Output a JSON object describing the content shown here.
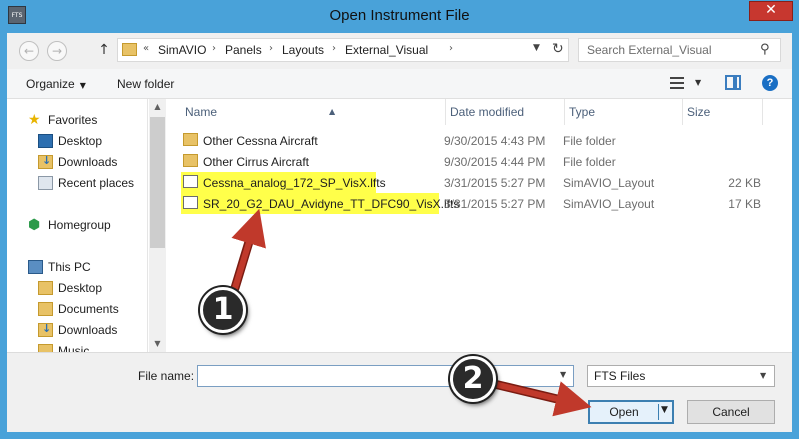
{
  "window": {
    "title": "Open Instrument File",
    "app_icon_text": "FTS",
    "close_symbol": "✕"
  },
  "nav": {
    "back_symbol": "←",
    "forward_symbol": "→",
    "up_symbol": "↑"
  },
  "address": {
    "prefix": "«",
    "crumbs": [
      "SimAVIO",
      "Panels",
      "Layouts",
      "External_Visual"
    ],
    "separator": "›",
    "dropdown_symbol": "▼",
    "refresh_symbol": "↻"
  },
  "search": {
    "placeholder": "Search External_Visual",
    "icon_symbol": "⚲"
  },
  "toolbar": {
    "organize_label": "Organize",
    "organize_caret": "▼",
    "new_folder_label": "New folder",
    "view_caret": "▼",
    "help_symbol": "?"
  },
  "sidebar": {
    "items": [
      {
        "label": "Favorites",
        "icon": "star-icon"
      },
      {
        "label": "Desktop",
        "icon": "desktop-icon"
      },
      {
        "label": "Downloads",
        "icon": "downloads-icon"
      },
      {
        "label": "Recent places",
        "icon": "recent-places-icon"
      },
      {
        "label": "Homegroup",
        "icon": "homegroup-icon"
      },
      {
        "label": "This PC",
        "icon": "this-pc-icon"
      },
      {
        "label": "Desktop",
        "icon": "desktop-icon"
      },
      {
        "label": "Documents",
        "icon": "documents-icon"
      },
      {
        "label": "Downloads",
        "icon": "downloads-icon"
      },
      {
        "label": "Music",
        "icon": "music-icon"
      }
    ],
    "star_symbol": "★",
    "home_symbol": "⬢",
    "scroll_up": "▲",
    "scroll_down": "▼"
  },
  "columns": {
    "name": "Name",
    "date": "Date modified",
    "type": "Type",
    "size": "Size",
    "sort_symbol": "▲"
  },
  "files": [
    {
      "name": "Other Cessna Aircraft",
      "date": "9/30/2015 4:43 PM",
      "type": "File folder",
      "size": "",
      "icon": "folder-icon",
      "highlighted": false
    },
    {
      "name": "Other Cirrus Aircraft",
      "date": "9/30/2015 4:44 PM",
      "type": "File folder",
      "size": "",
      "icon": "folder-icon",
      "highlighted": false
    },
    {
      "name": "Cessna_analog_172_SP_VisX.lfts",
      "date": "3/31/2015 5:27 PM",
      "type": "SimAVIO_Layout",
      "size": "22 KB",
      "icon": "file-icon",
      "highlighted": true
    },
    {
      "name": "SR_20_G2_DAU_Avidyne_TT_DFC90_VisX.lfts",
      "date": "3/31/2015 5:27 PM",
      "type": "SimAVIO_Layout",
      "size": "17 KB",
      "icon": "file-icon",
      "highlighted": true
    }
  ],
  "footer": {
    "filename_label": "File name:",
    "filename_value": "",
    "filename_dd": "▼",
    "filter_value": "FTS Files",
    "filter_dd": "▼",
    "open_label": "Open",
    "open_caret": "▼",
    "cancel_label": "Cancel"
  },
  "annotations": {
    "step1": "1",
    "step2": "2"
  },
  "colors": {
    "highlight": "#ffff4a",
    "arrow": "#c0392b",
    "titlebar": "#49a2d9"
  }
}
